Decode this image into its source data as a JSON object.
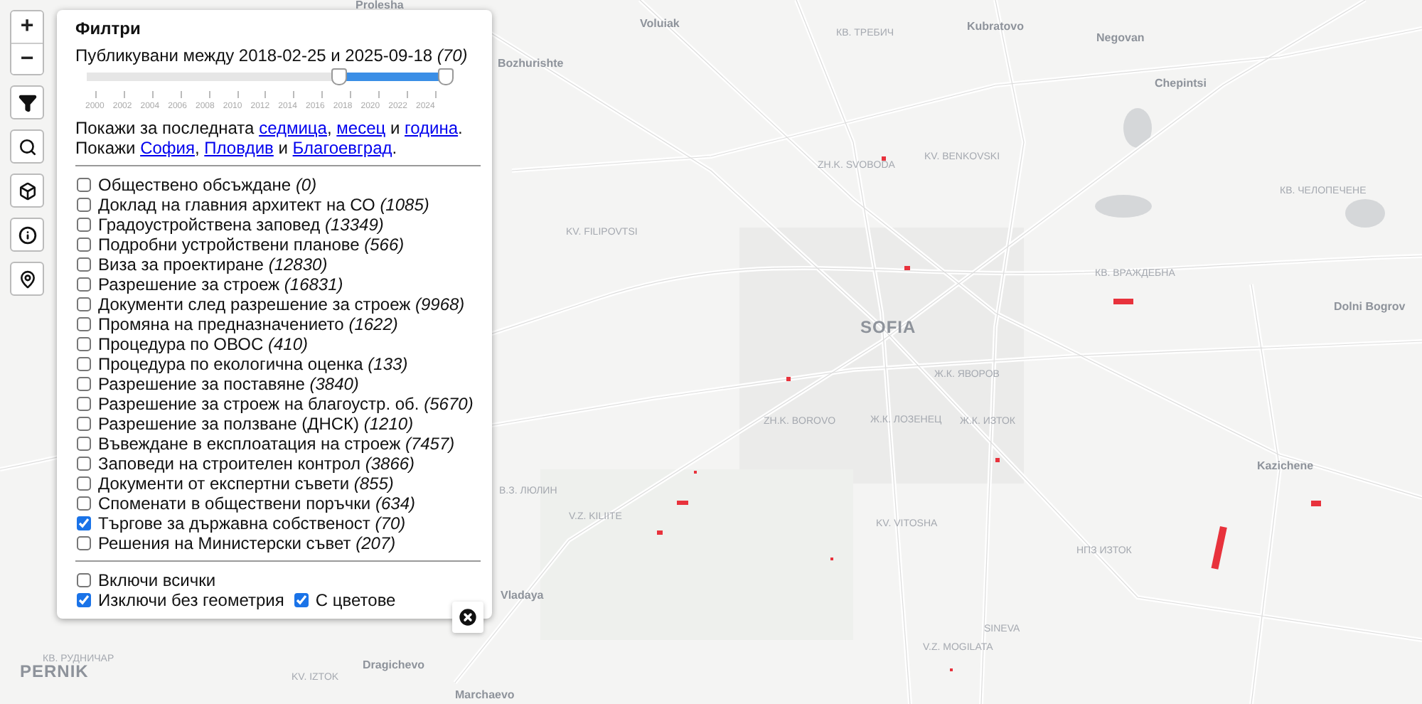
{
  "map_controls": [
    {
      "kind": "zoom-in",
      "label": "+"
    },
    {
      "kind": "zoom-out",
      "label": "−"
    },
    {
      "kind": "filter"
    },
    {
      "kind": "search"
    },
    {
      "kind": "cube"
    },
    {
      "kind": "info"
    },
    {
      "kind": "pin"
    }
  ],
  "map": {
    "places": [
      {
        "name": "Prolesha",
        "kind": "town"
      },
      {
        "name": "Voluiak",
        "kind": "town"
      },
      {
        "name": "КВ. ТРЕБИЧ",
        "kind": "district"
      },
      {
        "name": "Kubratovo",
        "kind": "town"
      },
      {
        "name": "Negovan",
        "kind": "town"
      },
      {
        "name": "Bozhurishte",
        "kind": "town"
      },
      {
        "name": "Chepintsi",
        "kind": "town"
      },
      {
        "name": "ZH.K. SVOBODA",
        "kind": "district"
      },
      {
        "name": "KV. BENKOVSKI",
        "kind": "district"
      },
      {
        "name": "КВ. ЧЕЛОПЕЧЕНЕ",
        "kind": "district"
      },
      {
        "name": "KV. FILIPOVTSI",
        "kind": "district"
      },
      {
        "name": "КВ. ВРАЖДЕБНА",
        "kind": "district"
      },
      {
        "name": "Dolni Bogrov",
        "kind": "town"
      },
      {
        "name": "SOFIA",
        "kind": "city"
      },
      {
        "name": "Ж.К. ЯВОРОВ",
        "kind": "district"
      },
      {
        "name": "ZH.K. BOROVO",
        "kind": "district"
      },
      {
        "name": "Ж.К. ЛОЗЕНЕЦ",
        "kind": "district"
      },
      {
        "name": "Ж.К. ИЗТОК",
        "kind": "district"
      },
      {
        "name": "В.З. ЛЮЛИН",
        "kind": "district"
      },
      {
        "name": "Kazichene",
        "kind": "town"
      },
      {
        "name": "V.Z. KILIITE",
        "kind": "district"
      },
      {
        "name": "KV. VITOSHA",
        "kind": "district"
      },
      {
        "name": "НПЗ ИЗТОК",
        "kind": "district"
      },
      {
        "name": "Vladaya",
        "kind": "town"
      },
      {
        "name": "SINEVA",
        "kind": "district"
      },
      {
        "name": "V.Z. MOGILATA",
        "kind": "district"
      },
      {
        "name": "КВ. РУДНИЧАР",
        "kind": "district"
      },
      {
        "name": "PERNIK",
        "kind": "city"
      },
      {
        "name": "KV. IZTOK",
        "kind": "district"
      },
      {
        "name": "Dragichevo",
        "kind": "town"
      },
      {
        "name": "Marchaevo",
        "kind": "town"
      }
    ]
  },
  "filters": {
    "title": "Филтри",
    "period": {
      "text": "Публикувани между 2018-02-25 и 2025-09-18",
      "count": "(70)"
    },
    "slider": {
      "from": {
        "level": 0.7
      },
      "to": {
        "level": 0.995
      },
      "ticks": [
        "2000",
        "2002",
        "2004",
        "2006",
        "2008",
        "2010",
        "2012",
        "2014",
        "2016",
        "2018",
        "2020",
        "2022",
        "2024"
      ]
    },
    "quick_links": [
      [
        {
          "kind": "text",
          "text": "Покажи за последната "
        },
        {
          "kind": "link",
          "text": "седмица"
        },
        {
          "kind": "text",
          "text": ", "
        },
        {
          "kind": "link",
          "text": "месец"
        },
        {
          "kind": "text",
          "text": " и "
        },
        {
          "kind": "link",
          "text": "година"
        },
        {
          "kind": "text",
          "text": "."
        }
      ],
      [
        {
          "kind": "text",
          "text": "Покажи "
        },
        {
          "kind": "link",
          "text": "София"
        },
        {
          "kind": "text",
          "text": ", "
        },
        {
          "kind": "link",
          "text": "Пловдив"
        },
        {
          "kind": "text",
          "text": " и "
        },
        {
          "kind": "link",
          "text": "Благоевград"
        },
        {
          "kind": "text",
          "text": "."
        }
      ]
    ],
    "categories": [
      {
        "label": "Обществено обсъждане",
        "count": "(0)",
        "checked": false
      },
      {
        "label": "Доклад на главния архитект на СО",
        "count": "(1085)",
        "checked": false
      },
      {
        "label": "Градоустройствена заповед",
        "count": "(13349)",
        "checked": false
      },
      {
        "label": "Подробни устройствени планове",
        "count": "(566)",
        "checked": false
      },
      {
        "label": "Виза за проектиране",
        "count": "(12830)",
        "checked": false
      },
      {
        "label": "Разрешение за строеж",
        "count": "(16831)",
        "checked": false
      },
      {
        "label": "Документи след разрешение за строеж",
        "count": "(9968)",
        "checked": false
      },
      {
        "label": "Промяна на предназначението",
        "count": "(1622)",
        "checked": false
      },
      {
        "label": "Процедура по ОВОС",
        "count": "(410)",
        "checked": false
      },
      {
        "label": "Процедура по екологична оценка",
        "count": "(133)",
        "checked": false
      },
      {
        "label": "Разрешение за поставяне",
        "count": "(3840)",
        "checked": false
      },
      {
        "label": "Разрешение за строеж на благоустр. об.",
        "count": "(5670)",
        "checked": false
      },
      {
        "label": "Разрешение за ползване (ДНСК)",
        "count": "(1210)",
        "checked": false
      },
      {
        "label": "Въвеждане в експлоатация на строеж",
        "count": "(7457)",
        "checked": false
      },
      {
        "label": "Заповеди на строителен контрол",
        "count": "(3866)",
        "checked": false
      },
      {
        "label": "Документи от експертни съвети",
        "count": "(855)",
        "checked": false
      },
      {
        "label": "Споменати в обществени поръчки",
        "count": "(634)",
        "checked": false
      },
      {
        "label": "Търгове за държавна собственост",
        "count": "(70)",
        "checked": true
      },
      {
        "label": "Решения на Министерски съвет",
        "count": "(207)",
        "checked": false
      }
    ],
    "options": [
      [
        {
          "label": "Включи всички",
          "checked": false
        }
      ],
      [
        {
          "label": "Изключи без геометрия",
          "checked": true
        },
        {
          "label": "С цветове",
          "checked": true
        }
      ]
    ]
  }
}
